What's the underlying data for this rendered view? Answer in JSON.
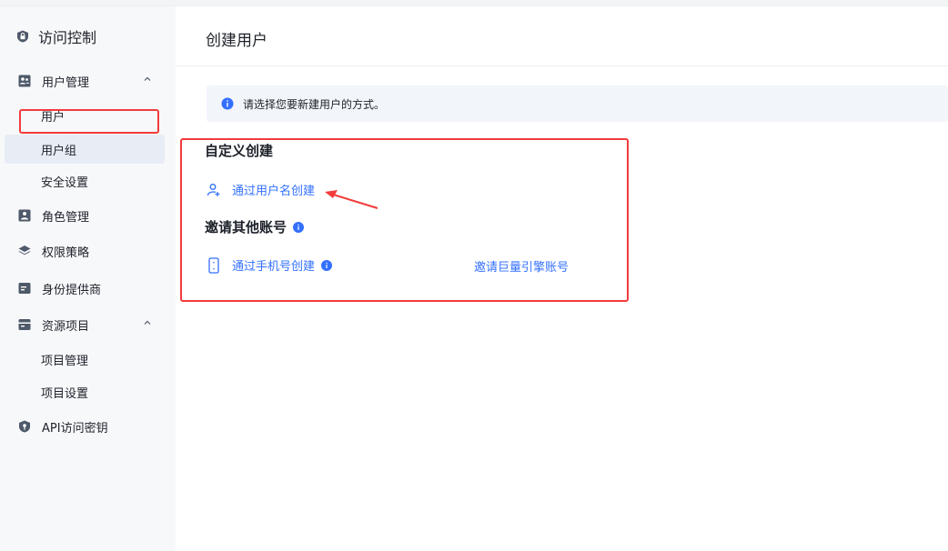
{
  "colors": {
    "accent": "#3370ff",
    "highlight": "#f23b3b",
    "sidebar_bg": "#f7f8fa",
    "selected_bg": "#e8ecf4"
  },
  "sidebar": {
    "title": "访问控制",
    "title_icon": "shield-lock-icon",
    "items": [
      {
        "label": "用户管理",
        "icon": "users-icon",
        "expanded": true
      },
      {
        "label": "用户",
        "highlighted": true
      },
      {
        "label": "用户组",
        "selected": true
      },
      {
        "label": "安全设置"
      },
      {
        "label": "角色管理",
        "icon": "role-icon"
      },
      {
        "label": "权限策略",
        "icon": "layers-icon"
      },
      {
        "label": "身份提供商",
        "icon": "id-card-icon"
      },
      {
        "label": "资源项目",
        "icon": "folder-icon",
        "expanded": true
      },
      {
        "label": "项目管理"
      },
      {
        "label": "项目设置"
      },
      {
        "label": "API访问密钥",
        "icon": "key-icon"
      }
    ]
  },
  "main": {
    "title": "创建用户",
    "info": "请选择您要新建用户的方式。",
    "custom_section": {
      "title": "自定义创建",
      "by_username": "通过用户名创建"
    },
    "invite_section": {
      "title": "邀请其他账号",
      "by_phone": "通过手机号创建",
      "invite_ocean": "邀请巨量引擎账号"
    }
  }
}
